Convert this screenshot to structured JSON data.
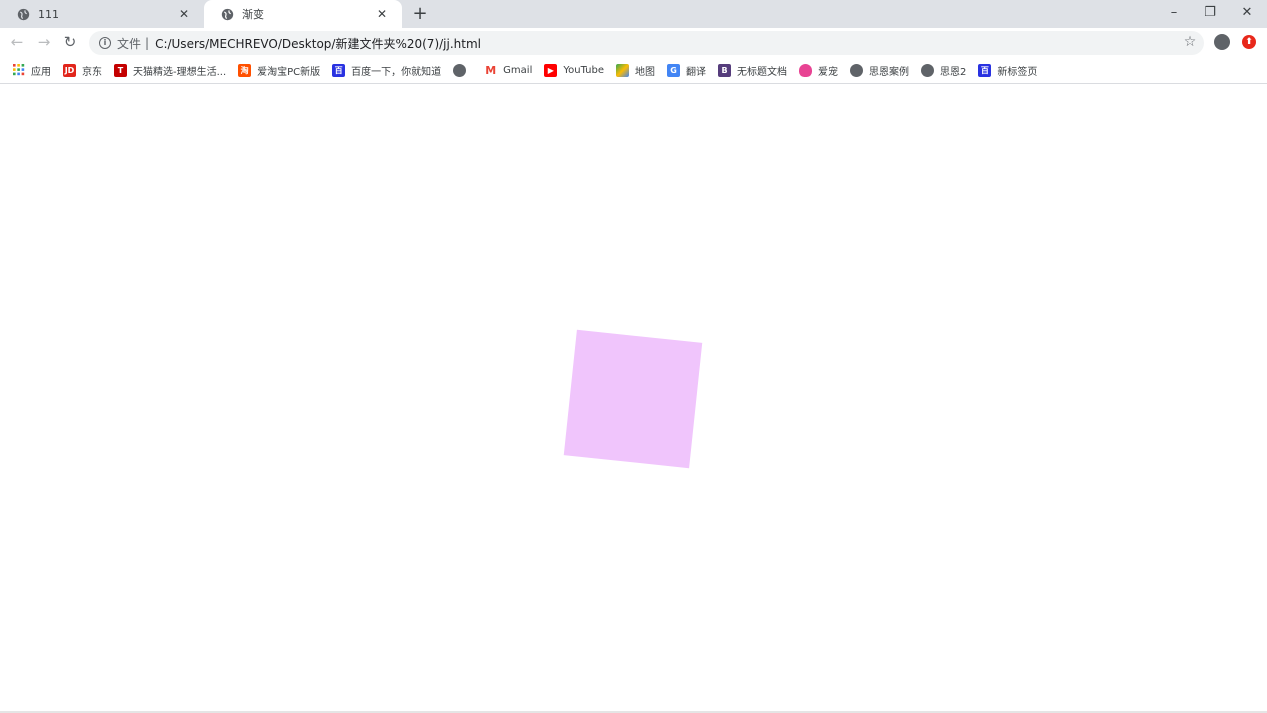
{
  "tabs": [
    {
      "title": "111",
      "active": false
    },
    {
      "title": "渐变",
      "active": true
    }
  ],
  "new_tab_label": "+",
  "window_controls": {
    "minimize": "–",
    "restore": "❐",
    "close": "✕"
  },
  "omnibox": {
    "scheme_label": "文件",
    "separator": "|",
    "url": "C:/Users/MECHREVO/Desktop/新建文件夹%20(7)/jj.html"
  },
  "bookmarks": [
    {
      "label": "应用",
      "icon": "apps-grid-icon",
      "color": "#4285f4"
    },
    {
      "label": "京东",
      "icon": "jd-icon",
      "color": "#e1251b",
      "glyph": "JD"
    },
    {
      "label": "天猫精选-理想生活...",
      "icon": "tmall-icon",
      "color": "#c40000",
      "glyph": "T"
    },
    {
      "label": "爱淘宝PC新版",
      "icon": "aitaobao-icon",
      "color": "#ff5000",
      "glyph": "淘"
    },
    {
      "label": "百度一下，你就知道",
      "icon": "baidu-icon",
      "color": "#2932e1",
      "glyph": "百"
    },
    {
      "label": "",
      "icon": "globe-icon",
      "color": "#5f6368"
    },
    {
      "label": "Gmail",
      "icon": "gmail-icon",
      "color": "#ea4335",
      "glyph": "M"
    },
    {
      "label": "YouTube",
      "icon": "youtube-icon",
      "color": "#ff0000",
      "glyph": "▶"
    },
    {
      "label": "地图",
      "icon": "maps-icon",
      "color": "#34a853"
    },
    {
      "label": "翻译",
      "icon": "translate-icon",
      "color": "#4285f4",
      "glyph": "G"
    },
    {
      "label": "无标题文档",
      "icon": "bootstrap-icon",
      "color": "#563d7c",
      "glyph": "B"
    },
    {
      "label": "爱宠",
      "icon": "pet-icon",
      "color": "#e84393"
    },
    {
      "label": "思恩案例",
      "icon": "globe-icon",
      "color": "#5f6368"
    },
    {
      "label": "思恩2",
      "icon": "globe-icon",
      "color": "#5f6368"
    },
    {
      "label": "新标签页",
      "icon": "baidu-icon",
      "color": "#2932e1",
      "glyph": "百"
    }
  ],
  "content": {
    "square_color": "#f0c5fc"
  }
}
